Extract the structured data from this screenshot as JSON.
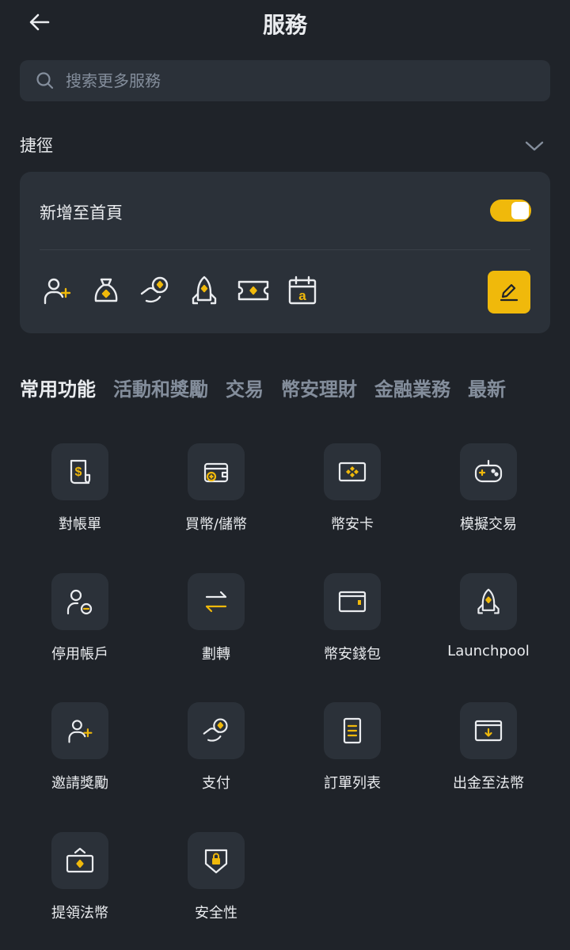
{
  "header": {
    "title": "服務"
  },
  "search": {
    "placeholder": "搜索更多服務"
  },
  "shortcut": {
    "title": "捷徑",
    "add_home_label": "新增至首頁",
    "add_home_enabled": true
  },
  "tabs": [
    {
      "label": "常用功能"
    },
    {
      "label": "活動和獎勵"
    },
    {
      "label": "交易"
    },
    {
      "label": "幣安理財"
    },
    {
      "label": "金融業務"
    },
    {
      "label": "最新"
    }
  ],
  "services": [
    {
      "label": "對帳單",
      "icon": "statement-icon"
    },
    {
      "label": "買幣/儲幣",
      "icon": "buy-crypto-icon"
    },
    {
      "label": "幣安卡",
      "icon": "binance-card-icon"
    },
    {
      "label": "模擬交易",
      "icon": "gamepad-icon"
    },
    {
      "label": "停用帳戶",
      "icon": "disable-account-icon"
    },
    {
      "label": "劃轉",
      "icon": "transfer-icon"
    },
    {
      "label": "幣安錢包",
      "icon": "wallet-icon"
    },
    {
      "label": "Launchpool",
      "icon": "rocket-icon"
    },
    {
      "label": "邀請獎勵",
      "icon": "invite-icon"
    },
    {
      "label": "支付",
      "icon": "pay-icon"
    },
    {
      "label": "訂單列表",
      "icon": "order-list-icon"
    },
    {
      "label": "出金至法幣",
      "icon": "withdraw-icon"
    },
    {
      "label": "提領法幣",
      "icon": "fiat-withdraw-icon"
    },
    {
      "label": "安全性",
      "icon": "security-icon"
    }
  ],
  "colors": {
    "accent": "#f0b90b",
    "background": "#1f2329",
    "card": "#2b3139",
    "muted": "#848e9c"
  }
}
